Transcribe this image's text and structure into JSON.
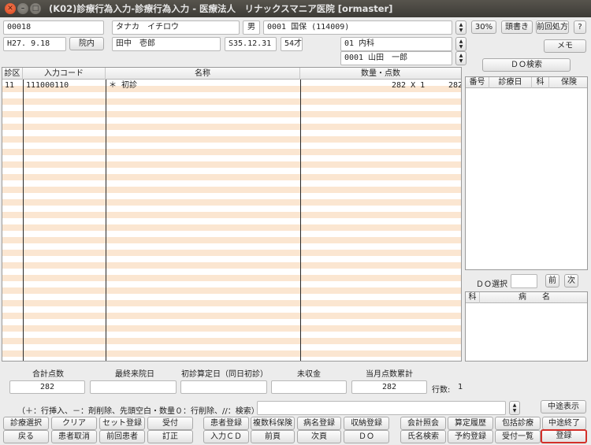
{
  "window": {
    "title": "(K02)診療行為入力-診療行為入力 - 医療法人　リナックスマニア医院  [ormaster]",
    "close_glyph": "✕",
    "min_glyph": "–",
    "max_glyph": "□"
  },
  "patient": {
    "id": "00018",
    "kana_name": "タナカ　イチロウ",
    "sex": "男",
    "insurance": "0001 国保 (114009)",
    "rate": "30%",
    "date": "H27. 9.18",
    "visit_type": "院内",
    "name": "田中　壱郎",
    "birth": "S35.12.31",
    "age": "54才",
    "department": "01 内科",
    "doctor": "0001 山田　一郎"
  },
  "top_buttons": {
    "kasho": "頭書き",
    "prev_rx": "前回処方",
    "help": "?",
    "memo": "メモ",
    "do_search": "ＤＯ検索"
  },
  "grid": {
    "headers": [
      "診区",
      "入力コード",
      "名称",
      "数量・点数"
    ],
    "rows": [
      {
        "kubun": "11",
        "code": "111000110",
        "name": "＊ 初診",
        "qty": "282 X 1",
        "points": "282"
      }
    ]
  },
  "history_panel": {
    "headers": [
      "番号",
      "診療日",
      "科",
      "保険"
    ]
  },
  "do_select": {
    "label": "ＤＯ選択",
    "value": "",
    "prev": "前",
    "next": "次"
  },
  "disease_panel": {
    "headers": [
      "科",
      "病　　名"
    ]
  },
  "summary": {
    "labels": [
      "合計点数",
      "最終来院日",
      "初診算定日（同日初診）",
      "未収金",
      "当月点数累計"
    ],
    "values": [
      "282",
      "",
      "",
      "",
      "282"
    ],
    "row_count_label": "行数:",
    "row_count": "1"
  },
  "command": {
    "hint": "（＋：行挿入、－：剤削除、先頭空白・数量０：行削除、//：検索）",
    "value": "",
    "interim_display": "中途表示"
  },
  "fkeys": {
    "row1": [
      "診療選択",
      "クリア",
      "セット登録",
      "受付",
      "患者登録",
      "複数科保険",
      "病名登録",
      "収納登録",
      "会計照会",
      "算定履歴",
      "包括診療",
      "中途終了"
    ],
    "row2": [
      "戻る",
      "患者取消",
      "前回患者",
      "訂正",
      "入力ＣＤ",
      "前頁",
      "次頁",
      "ＤＯ",
      "氏名検索",
      "予約登録",
      "受付一覧",
      "登録"
    ]
  },
  "colors": {
    "row_stripe": "#fbe6d1",
    "highlight_border": "#d3302a",
    "title_bar": "#4a4843"
  }
}
